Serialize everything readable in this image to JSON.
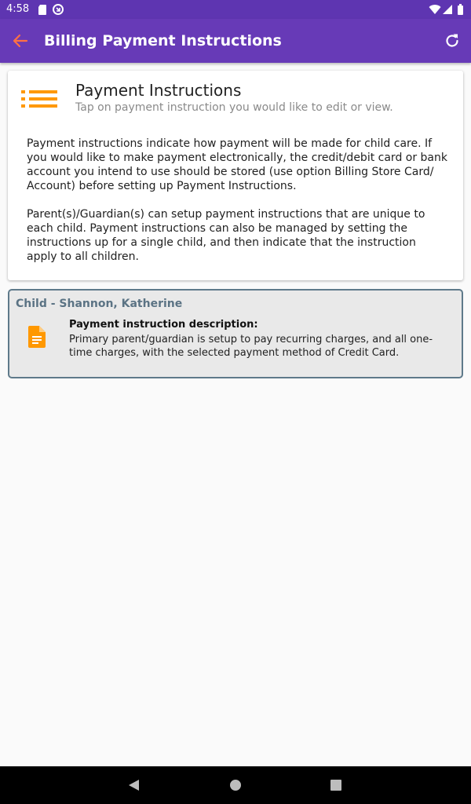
{
  "status_bar": {
    "time": "4:58",
    "icons": [
      "sd-card-icon",
      "sync-icon",
      "wifi-icon",
      "signal-icon",
      "battery-icon"
    ]
  },
  "app_bar": {
    "title": "Billing Payment Instructions",
    "back_icon": "arrow-back-icon",
    "refresh_icon": "refresh-icon",
    "colors": {
      "primary": "#673ab7",
      "primary_dark": "#5e35b1",
      "back_arrow": "#ff7043",
      "text": "#ffffff"
    }
  },
  "info_card": {
    "icon": "list-icon",
    "icon_color": "#ff9800",
    "title": "Payment Instructions",
    "subtitle": "Tap on payment instruction you would like to edit or view.",
    "paragraphs": [
      "Payment instructions indicate how payment will be made for child care.  If you would like to make payment electronically, the credit/debit card or bank account you intend to use should be stored (use option Billing Store Card/ Account) before setting up Payment Instructions.",
      "Parent(s)/Guardian(s) can setup payment instructions that are unique to each child.  Payment instructions can also be managed by setting the instructions up for a single child, and then indicate that the instruction apply to all children."
    ]
  },
  "child_cards": [
    {
      "child_name": "Child - Shannon, Katherine",
      "icon": "document-icon",
      "icon_color": "#ff9800",
      "description_label": "Payment instruction description:",
      "description": "Primary parent/guardian is setup to pay recurring charges, and all one-time charges, with the selected payment method of Credit Card."
    }
  ],
  "nav_bar": {
    "icons": [
      "back-triangle-icon",
      "home-circle-icon",
      "recents-square-icon"
    ]
  }
}
